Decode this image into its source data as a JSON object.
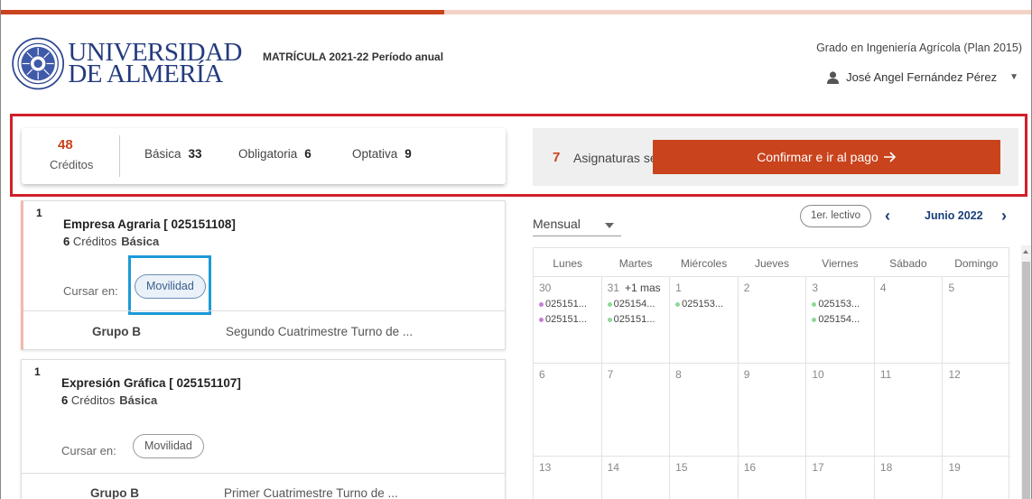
{
  "header": {
    "university_line1": "UNIVERSIDAD",
    "university_line2": "DE ALMERÍA",
    "matricula": "MATRÍCULA 2021-22 Período anual",
    "grado": "Grado en Ingeniería Agrícola (Plan 2015)",
    "user_name": "José Angel Fernández Pérez",
    "progress": 0.43
  },
  "credits": {
    "total": "48",
    "total_label": "Créditos",
    "basica_label": "Básica",
    "basica_value": "33",
    "obligatoria_label": "Obligatoria",
    "obligatoria_value": "6",
    "optativa_label": "Optativa",
    "optativa_value": "9"
  },
  "selection": {
    "count": "7",
    "label": "Asignaturas seleccionadas",
    "confirm_button": "Confirmar e ir al pago"
  },
  "courses": [
    {
      "number": "1",
      "title": "Empresa Agraria [ 025151108]",
      "credits_num": "6",
      "credits_label": "Créditos",
      "type": "Básica",
      "cursar_label": "Cursar en:",
      "pill": "Movilidad",
      "grupo": "Grupo B",
      "cuatrimestre": "Segundo Cuatrimestre  Turno de ..."
    },
    {
      "number": "1",
      "title": "Expresión Gráfica [ 025151107]",
      "credits_num": "6",
      "credits_label": "Créditos",
      "type": "Básica",
      "cursar_label": "Cursar en:",
      "pill": "Movilidad",
      "grupo": "Grupo B",
      "cuatrimestre": "Primer Cuatrimestre    Turno de ..."
    }
  ],
  "calendar": {
    "view": "Mensual",
    "lectivo": "1er. lectivo",
    "month": "Junio 2022",
    "days": [
      "Lunes",
      "Martes",
      "Miércoles",
      "Jueves",
      "Viernes",
      "Sábado",
      "Domingo"
    ],
    "week1": {
      "dates": [
        "30",
        "31",
        "1",
        "2",
        "3",
        "4",
        "5"
      ],
      "more": "+1 mas",
      "events": {
        "mon_1": "025151...",
        "mon_2": "025151...",
        "tue_1": "025154...",
        "tue_2": "025151...",
        "wed_1": "025153...",
        "fri_1": "025153...",
        "fri_2": "025154..."
      }
    },
    "week2": {
      "dates": [
        "6",
        "7",
        "8",
        "9",
        "10",
        "11",
        "12"
      ]
    },
    "week3": {
      "dates": [
        "13",
        "14",
        "15",
        "16",
        "17",
        "18",
        "19"
      ]
    }
  },
  "colors": {
    "accent": "#c9431c",
    "navy": "#1a3f7a",
    "dot_purple": "#c77fd6",
    "dot_green": "#8ed99a",
    "highlight_red": "#d11f2c",
    "highlight_blue": "#1c9ad6"
  }
}
